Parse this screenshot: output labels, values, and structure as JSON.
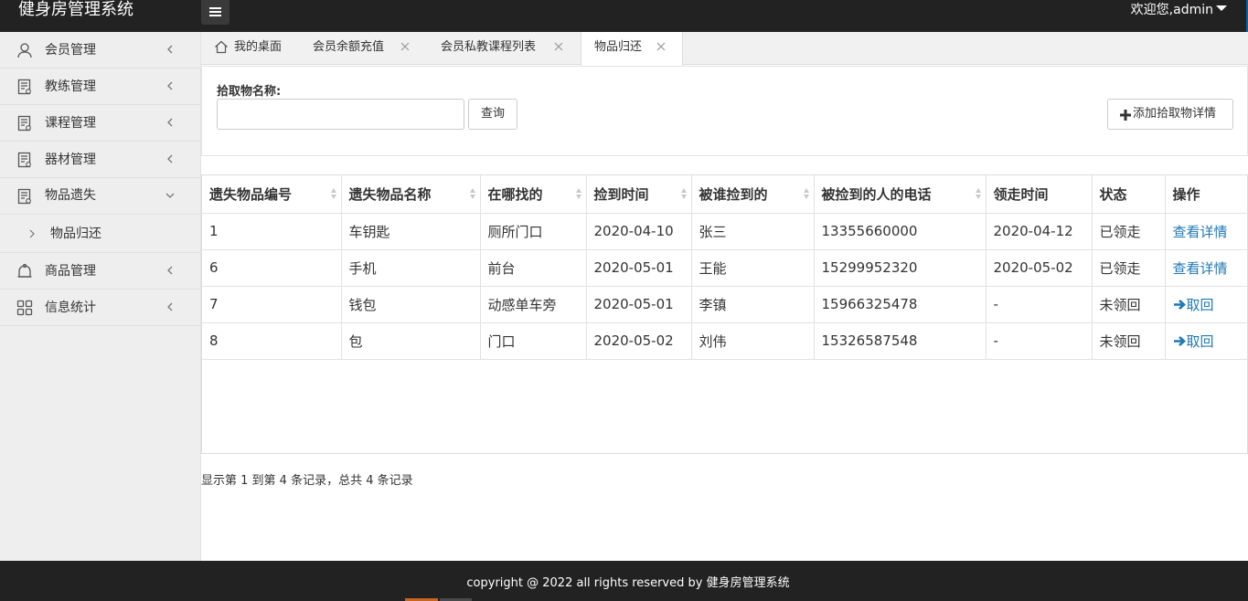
{
  "app": {
    "title": "健身房管理系统",
    "welcome": "欢迎您,admin"
  },
  "sidebar": {
    "items": [
      {
        "label": "会员管理",
        "icon": "user-icon"
      },
      {
        "label": "教练管理",
        "icon": "document-icon"
      },
      {
        "label": "课程管理",
        "icon": "document-icon"
      },
      {
        "label": "器材管理",
        "icon": "document-icon"
      },
      {
        "label": "物品遗失",
        "icon": "document-icon",
        "expanded": true
      },
      {
        "label": "商品管理",
        "icon": "goods-icon"
      },
      {
        "label": "信息统计",
        "icon": "grid-icon"
      }
    ],
    "subitem": {
      "label": "物品归还"
    }
  },
  "tabs": [
    {
      "label": "我的桌面",
      "icon": "home-icon"
    },
    {
      "label": "会员余额充值",
      "closable": true
    },
    {
      "label": "会员私教课程列表",
      "closable": true
    },
    {
      "label": "物品归还",
      "closable": true,
      "active": true
    }
  ],
  "search": {
    "label": "拾取物名称:",
    "value": "",
    "button": "查询",
    "add_button": "添加拾取物详情"
  },
  "table": {
    "headers": [
      "遗失物品编号",
      "遗失物品名称",
      "在哪找的",
      "捡到时间",
      "被谁捡到的",
      "被捡到的人的电话",
      "领走时间",
      "状态",
      "操作"
    ],
    "rows": [
      {
        "id": "1",
        "name": "车钥匙",
        "place": "厕所门口",
        "found": "2020-04-10",
        "finder": "张三",
        "phone": "13355660000",
        "taken": "2020-04-12",
        "status": "已领走",
        "action": "查看详情",
        "action_type": "view"
      },
      {
        "id": "6",
        "name": "手机",
        "place": "前台",
        "found": "2020-05-01",
        "finder": "王能",
        "phone": "15299952320",
        "taken": "2020-05-02",
        "status": "已领走",
        "action": "查看详情",
        "action_type": "view"
      },
      {
        "id": "7",
        "name": "钱包",
        "place": "动感单车旁",
        "found": "2020-05-01",
        "finder": "李镇",
        "phone": "15966325478",
        "taken": "-",
        "status": "未领回",
        "action": "取回",
        "action_type": "retrieve"
      },
      {
        "id": "8",
        "name": "包",
        "place": "门口",
        "found": "2020-05-02",
        "finder": "刘伟",
        "phone": "15326587548",
        "taken": "-",
        "status": "未领回",
        "action": "取回",
        "action_type": "retrieve"
      }
    ]
  },
  "summary": "显示第 1 到第 4 条记录，总共 4 条记录",
  "footer": {
    "copyright": "copyright @ 2022 all rights reserved by 健身房管理系统"
  },
  "colors": {
    "header_bg": "#222222",
    "sidebar_bg": "#eeeeee",
    "link": "#1f78b4"
  }
}
